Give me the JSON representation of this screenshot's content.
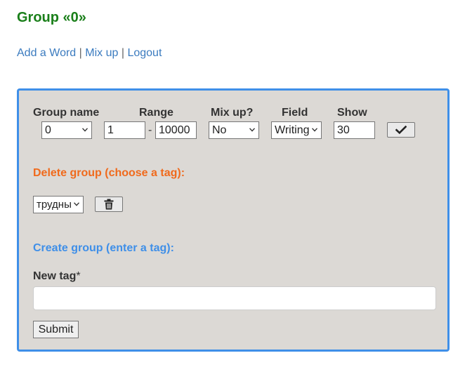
{
  "header": {
    "title": "Group «0»"
  },
  "nav": {
    "add_word": "Add a Word",
    "mix_up": "Mix up",
    "logout": "Logout",
    "separator": "|"
  },
  "settings": {
    "group_name_label": "Group name",
    "group_name_value": "0",
    "range_label": "Range",
    "range_from": "1",
    "range_separator": "-",
    "range_to": "10000",
    "mix_up_label": "Mix up?",
    "mix_up_value": "No",
    "field_label": "Field",
    "field_value": "Writing",
    "show_label": "Show",
    "show_value": "30",
    "apply_icon": "checkmark-icon"
  },
  "delete_group": {
    "heading": "Delete group (choose a tag):",
    "tag_value": "трудны",
    "delete_icon": "trash-icon"
  },
  "create_group": {
    "heading": "Create group (enter a tag):",
    "new_tag_label": "New tag",
    "required_mark": "*",
    "new_tag_value": "",
    "submit_label": "Submit"
  },
  "colors": {
    "title": "#1a7f1a",
    "link": "#3b7bbf",
    "panel_bg": "#dcd9d5",
    "panel_border": "#3f8fe8",
    "delete_heading": "#f06a1c",
    "create_heading": "#3f8fe8"
  }
}
